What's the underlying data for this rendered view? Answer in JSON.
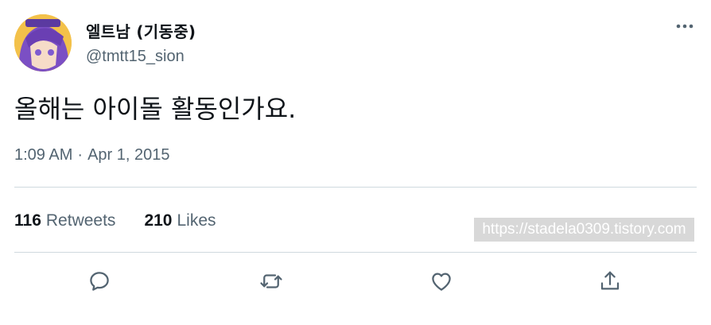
{
  "author": {
    "display_name": "엘트남 (기동중)",
    "handle": "@tmtt15_sion",
    "avatar": "avatar-image"
  },
  "tweet": {
    "text": "올해는 아이돌 활동인가요.",
    "time": "1:09 AM",
    "separator": "·",
    "date": "Apr 1, 2015"
  },
  "stats": {
    "retweets_count": "116",
    "retweets_label": "Retweets",
    "likes_count": "210",
    "likes_label": "Likes"
  },
  "watermark": "https://stadela0309.tistory.com",
  "icons": {
    "more": "more-icon",
    "reply": "reply-icon",
    "retweet": "retweet-icon",
    "like": "like-icon",
    "share": "share-icon"
  },
  "colors": {
    "text": "#0f1419",
    "secondary": "#536471",
    "divider": "#cfd9de"
  }
}
